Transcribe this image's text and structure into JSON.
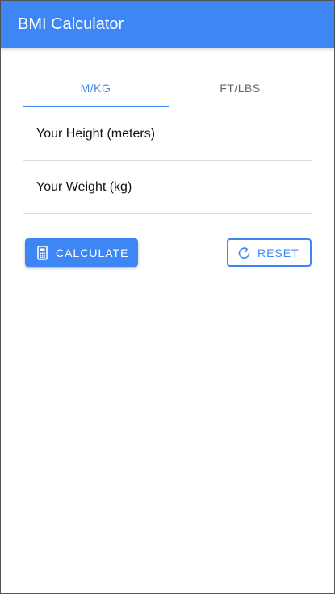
{
  "appbar": {
    "title": "BMI Calculator"
  },
  "tabs": [
    {
      "label": "M/KG",
      "active": true
    },
    {
      "label": "FT/LBS",
      "active": false
    }
  ],
  "form": {
    "height": {
      "placeholder": "Your Height (meters)",
      "value": ""
    },
    "weight": {
      "placeholder": "Your Weight (kg)",
      "value": ""
    }
  },
  "actions": {
    "calculate": {
      "label": "CALCULATE",
      "icon": "calculator-icon"
    },
    "reset": {
      "label": "RESET",
      "icon": "refresh-icon"
    }
  },
  "colors": {
    "primary": "#3f86f5",
    "divider": "#dcdcdc"
  }
}
